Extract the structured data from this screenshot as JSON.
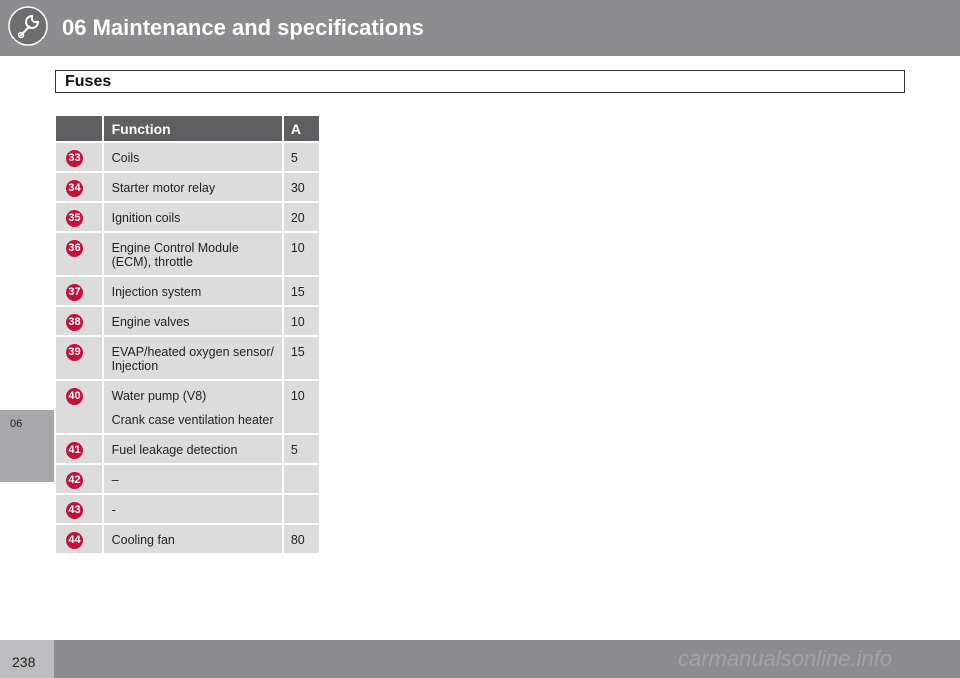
{
  "header": {
    "title": "06 Maintenance and specifications",
    "icon": "wrench-icon"
  },
  "sidebar": {
    "tab": "06"
  },
  "section": {
    "title": "Fuses"
  },
  "table": {
    "columns": [
      "",
      "Function",
      "A"
    ],
    "rows": [
      {
        "num": "33",
        "function": "Coils",
        "function2": "",
        "amp": "5"
      },
      {
        "num": "34",
        "function": "Starter motor relay",
        "function2": "",
        "amp": "30"
      },
      {
        "num": "35",
        "function": "Ignition coils",
        "function2": "",
        "amp": "20"
      },
      {
        "num": "36",
        "function": "Engine Control Module (ECM), throttle",
        "function2": "",
        "amp": "10"
      },
      {
        "num": "37",
        "function": "Injection system",
        "function2": "",
        "amp": "15"
      },
      {
        "num": "38",
        "function": "Engine valves",
        "function2": "",
        "amp": "10"
      },
      {
        "num": "39",
        "function": "EVAP/heated oxygen sensor/ Injection",
        "function2": "",
        "amp": "15"
      },
      {
        "num": "40",
        "function": "Water pump (V8)",
        "function2": "Crank case ventilation heater",
        "amp": "10"
      },
      {
        "num": "41",
        "function": "Fuel leakage detection",
        "function2": "",
        "amp": "5"
      },
      {
        "num": "42",
        "function": "–",
        "function2": "",
        "amp": ""
      },
      {
        "num": "43",
        "function": "-",
        "function2": "",
        "amp": ""
      },
      {
        "num": "44",
        "function": "Cooling fan",
        "function2": "",
        "amp": "80"
      }
    ]
  },
  "footer": {
    "page": "238",
    "watermark": "carmanualsonline.info"
  }
}
